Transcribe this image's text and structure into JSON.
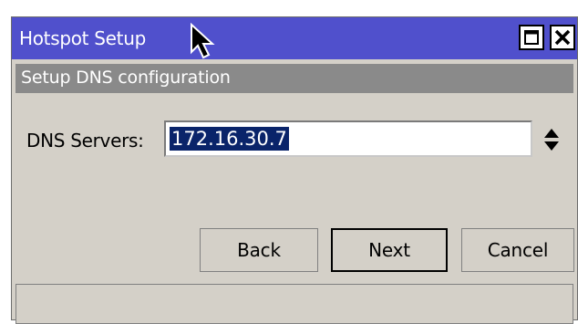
{
  "window": {
    "title": "Hotspot Setup"
  },
  "section": {
    "header": "Setup DNS configuration"
  },
  "form": {
    "dns_label": "DNS Servers:",
    "dns_value": "172.16.30.7"
  },
  "buttons": {
    "back": "Back",
    "next": "Next",
    "cancel": "Cancel"
  },
  "icons": {
    "maximize": "maximize-icon",
    "close": "close-icon",
    "spin": "up-down-arrows-icon",
    "cursor": "mouse-pointer-icon"
  },
  "colors": {
    "titlebar": "#5050cc",
    "section_header": "#8a8a8a",
    "window_bg": "#d4d0c8",
    "selection": "#0a246a"
  }
}
